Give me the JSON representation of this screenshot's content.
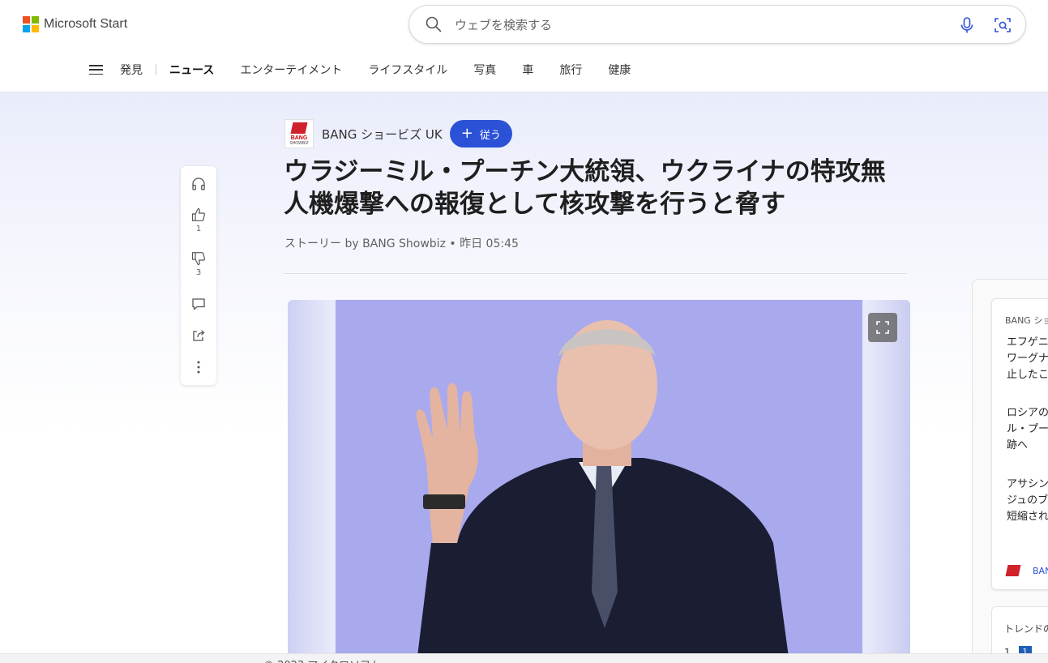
{
  "brand": {
    "name": "Microsoft Start",
    "logo_colors": [
      "#f25022",
      "#7fba00",
      "#00a4ef",
      "#ffb900"
    ]
  },
  "search": {
    "placeholder": "ウェブを検索する"
  },
  "nav": {
    "items": [
      {
        "label": "発見",
        "active": false
      },
      {
        "label": "ニュース",
        "active": true
      },
      {
        "label": "エンターテイメント",
        "active": false
      },
      {
        "label": "ライフスタイル",
        "active": false
      },
      {
        "label": "写真",
        "active": false
      },
      {
        "label": "車",
        "active": false
      },
      {
        "label": "旅行",
        "active": false
      },
      {
        "label": "健康",
        "active": false
      }
    ]
  },
  "article": {
    "publisher": "BANG ショービズ UK",
    "publisher_logo_text": "BANG",
    "publisher_logo_subtext": "SHOWBIZ",
    "follow_label": "従う",
    "title_line1": "ウラジーミル・プーチン大統領、ウクライナの特攻無",
    "title_line2": "人機爆撃への報復として核攻撃を行うと脅す",
    "byline": "ストーリー by BANG Showbiz • 昨日 05:45"
  },
  "actions": {
    "like_count": "1",
    "dislike_count": "3"
  },
  "side": {
    "header": "BANG ショ",
    "items": [
      {
        "lines": [
          "エフゲニ",
          "ワーグナ",
          "止したこ"
        ]
      },
      {
        "lines": [
          "ロシアの",
          "ル・プー",
          "跡へ"
        ]
      },
      {
        "lines": [
          "アサシン",
          "ジュのブ",
          "短縮され"
        ]
      }
    ],
    "footer": "BAN"
  },
  "trending": {
    "title": "トレンドの",
    "rank": "1",
    "badge": "1"
  },
  "footer": {
    "copyright": "© 2023 マイクロソフト"
  },
  "colors": {
    "accent": "#2b52d6",
    "publisher_red": "#d0222b",
    "hero_bg": "#a9a9ee"
  }
}
